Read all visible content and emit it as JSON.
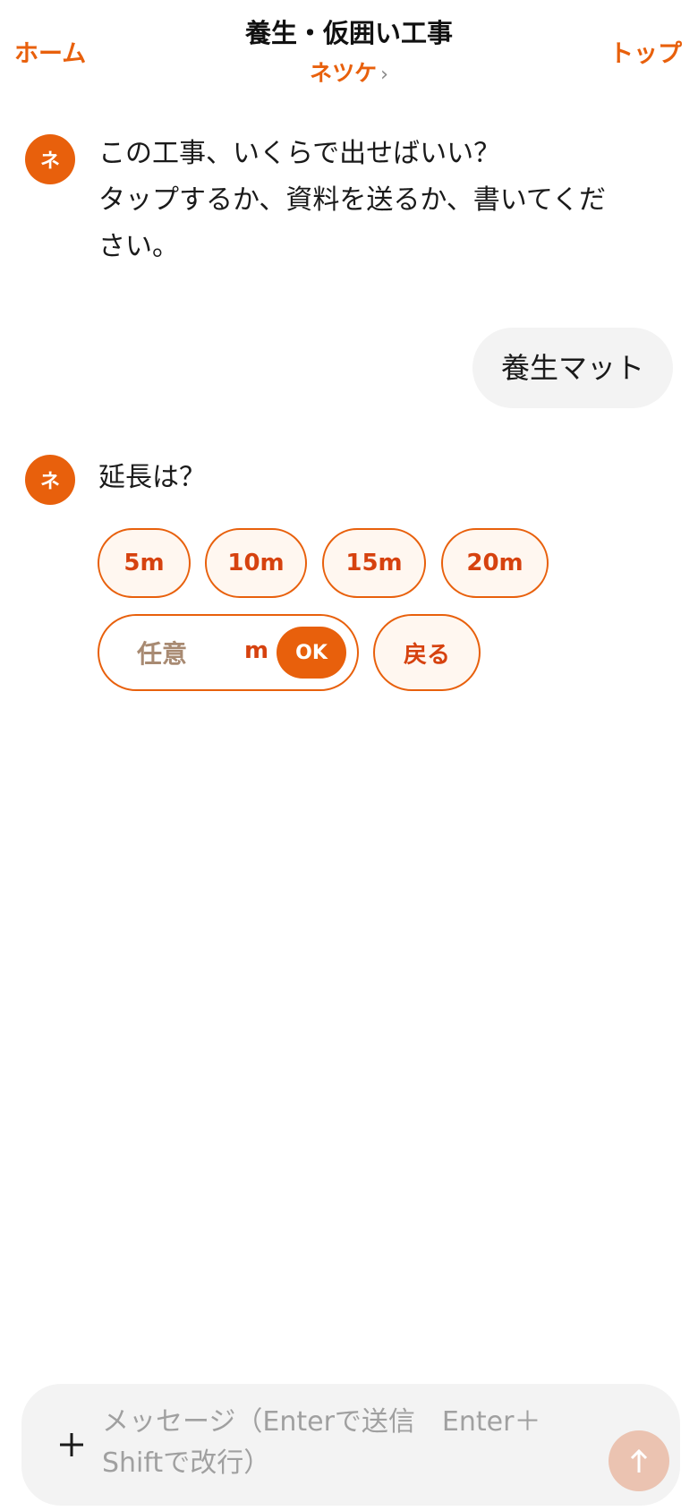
{
  "header": {
    "home_label": "ホーム",
    "title": "養生・仮囲い工事",
    "subtitle": "ネツケ",
    "subtitle_chevron": "›",
    "top_label": "トップ"
  },
  "messages": {
    "bot1": {
      "avatar": "ネ",
      "lines": [
        "この工事、いくらで出せばいい？",
        "タップするか、資料を送るか、書いてくだ",
        "さい。"
      ]
    },
    "user1": {
      "text": "養生マット"
    },
    "bot2": {
      "avatar": "ネ",
      "text": "延長は？"
    }
  },
  "options": {
    "chips": [
      "5m",
      "10m",
      "15m",
      "20m"
    ],
    "custom_placeholder": "任意",
    "custom_unit": "m",
    "ok_label": "OK",
    "back_label": "戻る"
  },
  "composer": {
    "placeholder": "メッセージ（Enterで送信　Enter＋Shiftで改行）",
    "plus_icon": "plus-icon",
    "send_icon": "arrow-up-icon"
  },
  "colors": {
    "accent": "#e8600c",
    "chip_text": "#d6420f",
    "send_disabled": "#ebc3b1",
    "bubble_bg": "#f3f3f3"
  }
}
